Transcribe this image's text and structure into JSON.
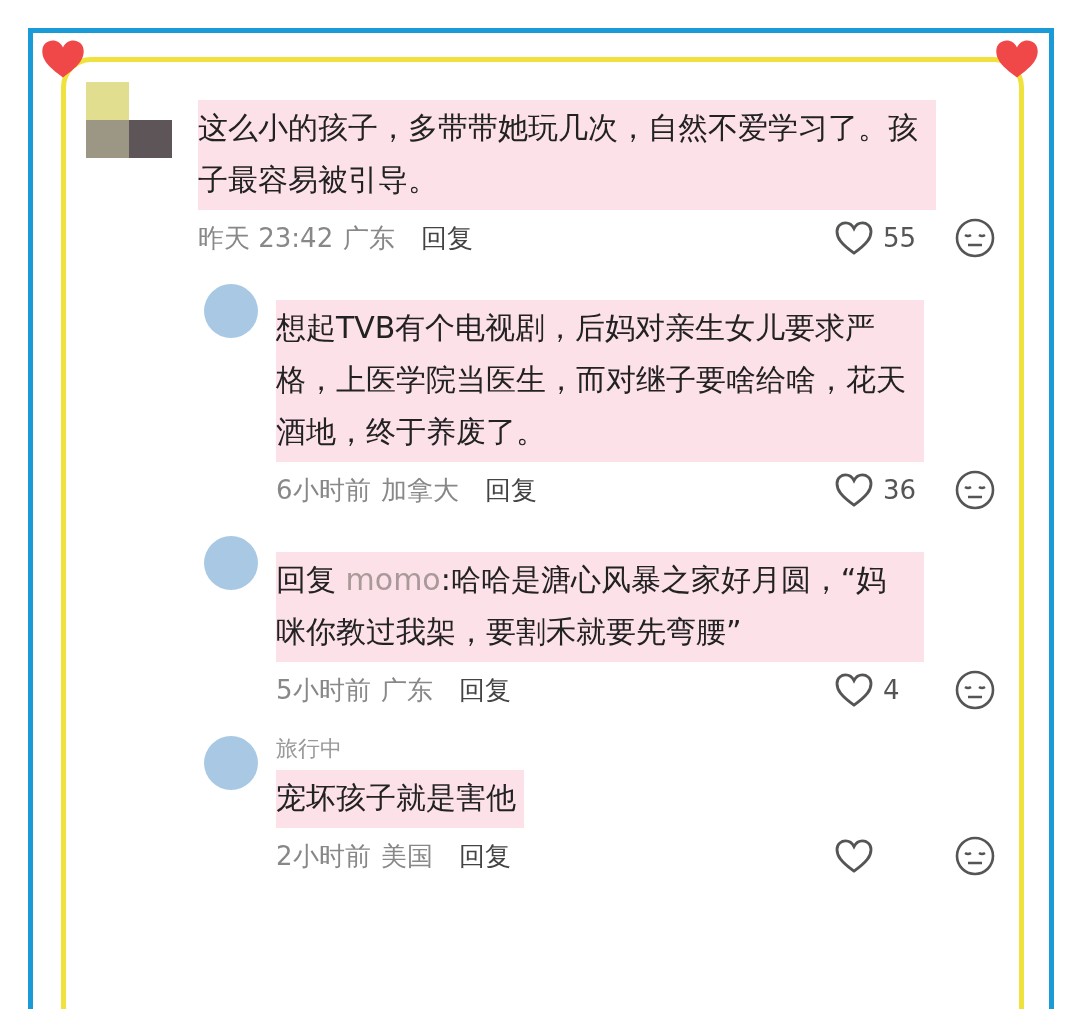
{
  "comments": [
    {
      "text": "这么小的孩子，多带带她玩几次，自然不爱学习了。孩子最容易被引导。",
      "time": "昨天 23:42",
      "location": "广东",
      "reply_button": "回复",
      "likes": "55",
      "children": [
        {
          "text": "想起TVB有个电视剧，后妈对亲生女儿要求严格，上医学院当医生，而对继子要啥给啥，花天酒地，终于养废了。",
          "time": "6小时前",
          "location": "加拿大",
          "reply_button": "回复",
          "likes": "36"
        },
        {
          "reply_prefix": "回复",
          "reply_to": "momo",
          "separator": ":",
          "text": "哈哈是溏心风暴之家好月圆，“妈咪你教过我架，要割禾就要先弯腰”",
          "time": "5小时前",
          "location": "广东",
          "reply_button": "回复",
          "likes": "4"
        },
        {
          "username": "旅行中",
          "text": "宠坏孩子就是害他",
          "time": "2小时前",
          "location": "美国",
          "reply_button": "回复"
        }
      ]
    }
  ]
}
